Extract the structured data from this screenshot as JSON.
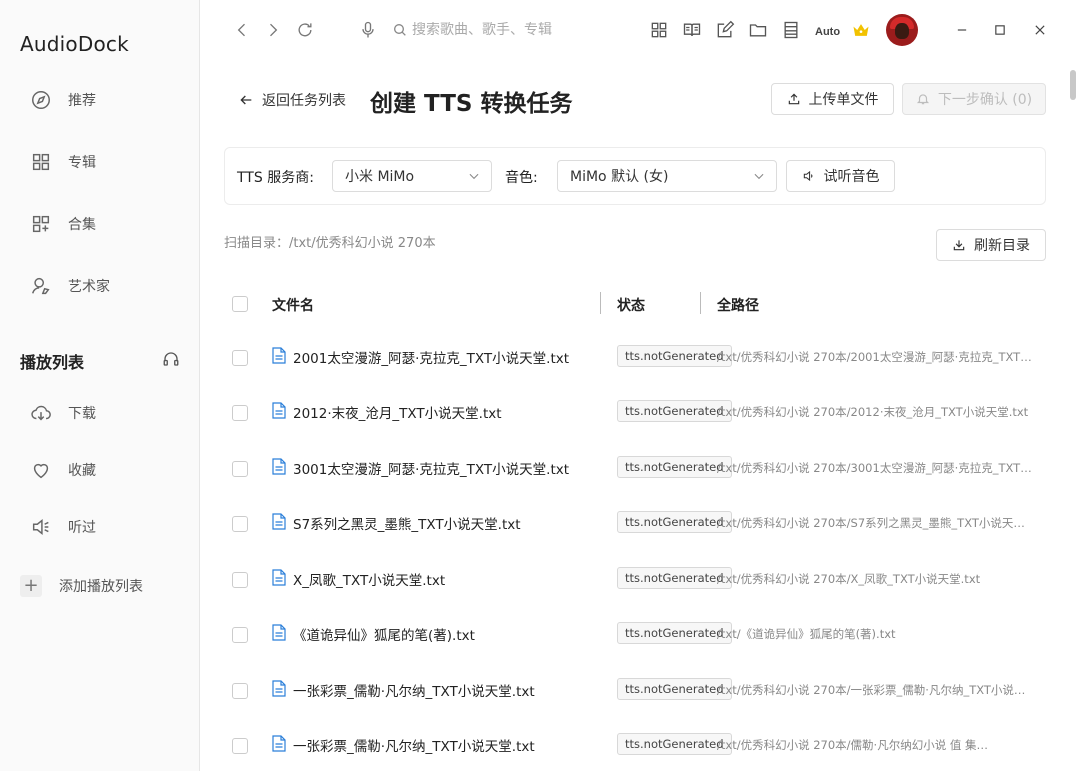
{
  "app": {
    "name": "AudioDock"
  },
  "sidebar": {
    "nav": [
      {
        "label": "推荐",
        "icon": "compass-icon"
      },
      {
        "label": "专辑",
        "icon": "grid-icon"
      },
      {
        "label": "合集",
        "icon": "collection-icon"
      },
      {
        "label": "艺术家",
        "icon": "artist-icon"
      }
    ],
    "playlist_title": "播放列表",
    "playlist": [
      {
        "label": "下载",
        "icon": "cloud-download-icon"
      },
      {
        "label": "收藏",
        "icon": "heart-icon"
      },
      {
        "label": "听过",
        "icon": "speaker-icon"
      }
    ],
    "add_playlist": "添加播放列表"
  },
  "topbar": {
    "search_placeholder": "搜索歌曲、歌手、专辑",
    "auto_label": "Auto"
  },
  "page": {
    "back_label": "返回任务列表",
    "title": "创建 TTS 转换任务",
    "upload_button": "上传单文件",
    "next_button": "下一步确认 (0)",
    "provider_label": "TTS 服务商:",
    "provider_value": "小米 MiMo",
    "voice_label": "音色:",
    "voice_value": "MiMo 默认 (女)",
    "preview_button": "试听音色",
    "scan_dir": "扫描目录：/txt/优秀科幻小说 270本",
    "refresh_button": "刷新目录"
  },
  "table": {
    "columns": [
      "文件名",
      "状态",
      "全路径"
    ],
    "rows": [
      {
        "name": "2001太空漫游_阿瑟·克拉克_TXT小说天堂.txt",
        "status": "tts.notGenerated",
        "path": "/txt/优秀科幻小说 270本/2001太空漫游_阿瑟·克拉克_TXT…"
      },
      {
        "name": "2012·末夜_沧月_TXT小说天堂.txt",
        "status": "tts.notGenerated",
        "path": "/txt/优秀科幻小说 270本/2012·末夜_沧月_TXT小说天堂.txt"
      },
      {
        "name": "3001太空漫游_阿瑟·克拉克_TXT小说天堂.txt",
        "status": "tts.notGenerated",
        "path": "/txt/优秀科幻小说 270本/3001太空漫游_阿瑟·克拉克_TXT…"
      },
      {
        "name": "S7系列之黑灵_墨熊_TXT小说天堂.txt",
        "status": "tts.notGenerated",
        "path": "/txt/优秀科幻小说 270本/S7系列之黑灵_墨熊_TXT小说天…"
      },
      {
        "name": "X_凤歌_TXT小说天堂.txt",
        "status": "tts.notGenerated",
        "path": "/txt/优秀科幻小说 270本/X_凤歌_TXT小说天堂.txt"
      },
      {
        "name": "《道诡异仙》狐尾的笔(著).txt",
        "status": "tts.notGenerated",
        "path": "/txt/《道诡异仙》狐尾的笔(著).txt"
      },
      {
        "name": "一张彩票_儒勒·凡尔纳_TXT小说天堂.txt",
        "status": "tts.notGenerated",
        "path": "/txt/优秀科幻小说 270本/一张彩票_儒勒·凡尔纳_TXT小说…"
      },
      {
        "name": "一张彩票_儒勒·凡尔纳_TXT小说天堂.txt",
        "status": "tts.notGenerated",
        "path": "/txt/优秀科幻小说 270本/儒勒·凡尔纳幻小说 值 集…"
      }
    ]
  },
  "colors": {
    "file_icon": "#2b7fd9",
    "crown": "#f2c200",
    "avatar": "#9b1c1c"
  }
}
